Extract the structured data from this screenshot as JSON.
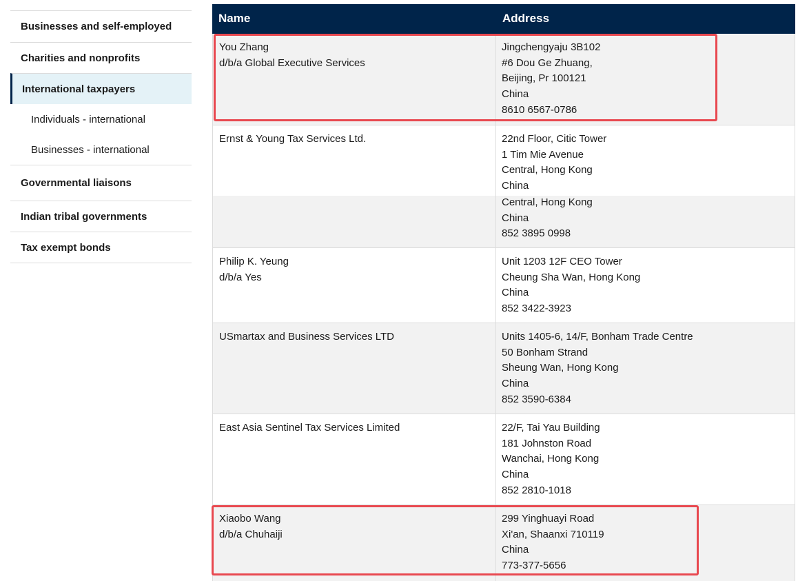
{
  "sidebar": {
    "items": [
      {
        "label": "Businesses and self-employed"
      },
      {
        "label": "Charities and nonprofits"
      },
      {
        "label": "International taxpayers"
      },
      {
        "label": "Individuals - international"
      },
      {
        "label": "Businesses - international"
      },
      {
        "label": "Governmental liaisons"
      },
      {
        "label": "Indian tribal governments"
      },
      {
        "label": "Tax exempt bonds"
      }
    ]
  },
  "table": {
    "headers": {
      "name": "Name",
      "address": "Address"
    },
    "rows": [
      {
        "name": [
          "You Zhang",
          "d/b/a Global Executive Services"
        ],
        "address": [
          "Jingchengyaju 3B102",
          "#6 Dou Ge Zhuang,",
          "Beijing, Pr 100121",
          "China",
          "8610 6567-0786"
        ]
      },
      {
        "name": [
          "Ernst & Young Tax Services Ltd."
        ],
        "address": [
          "22nd Floor, Citic Tower",
          "1 Tim Mie Avenue",
          "Central, Hong Kong",
          "China",
          "Central, Hong Kong",
          "China",
          "852 3895 0998"
        ]
      },
      {
        "name": [
          "Philip K. Yeung",
          "d/b/a Yes"
        ],
        "address": [
          "Unit 1203 12F CEO Tower",
          "Cheung Sha Wan, Hong Kong",
          "China",
          "852 3422-3923"
        ]
      },
      {
        "name": [
          "USmartax and Business Services LTD"
        ],
        "address": [
          "Units 1405-6, 14/F, Bonham Trade Centre",
          "50 Bonham Strand",
          "Sheung Wan, Hong Kong",
          "China",
          "852 3590-6384"
        ]
      },
      {
        "name": [
          "East Asia Sentinel Tax Services Limited"
        ],
        "address": [
          "22/F, Tai Yau Building",
          "181 Johnston Road",
          "Wanchai, Hong Kong",
          "China",
          "852 2810-1018"
        ]
      },
      {
        "name": [
          "Xiaobo Wang",
          "d/b/a Chuhaiji"
        ],
        "address": [
          "299 Yinghuayi Road",
          "Xi'an, Shaanxi 710119",
          "China",
          "773-377-5656"
        ]
      }
    ]
  },
  "colors": {
    "header_bg": "#00244a",
    "highlight": "#e8484f",
    "row_alt": "#f2f2f2",
    "nav_active_bg": "#e4f2f7"
  }
}
